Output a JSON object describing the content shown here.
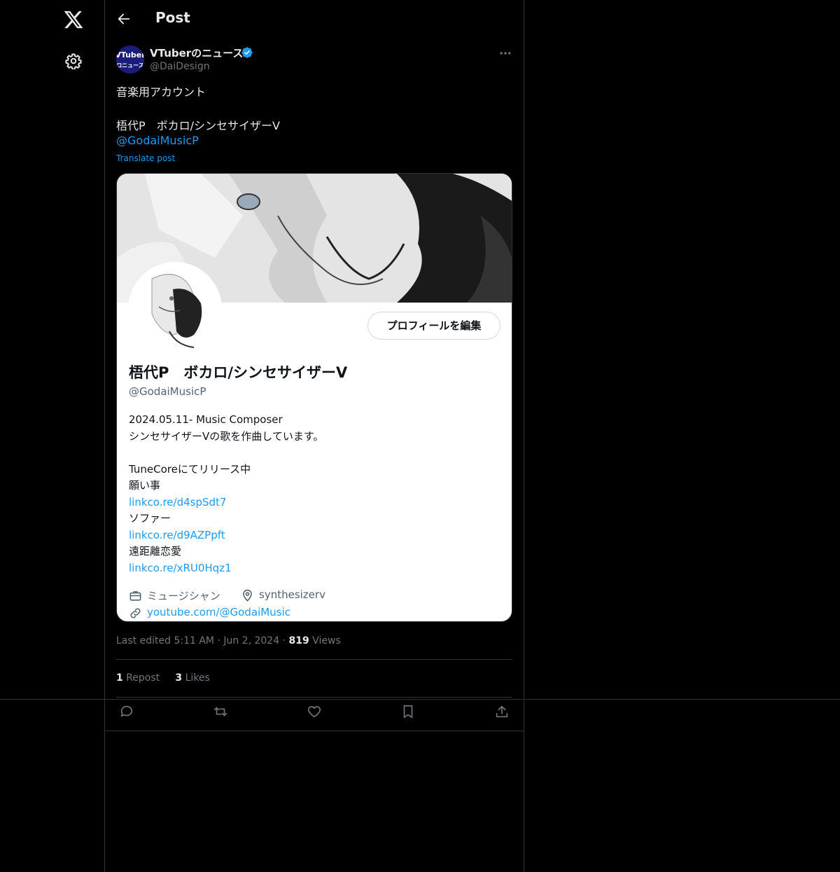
{
  "header": {
    "title": "Post"
  },
  "post": {
    "author_name": "VTuberのニュース",
    "author_handle": "@DaiDesign",
    "avatar_text": "VTuber ロニュース",
    "text": "音楽用アカウント\n\n梧代P　ボカロ/シンセサイザーV",
    "mention": "@GodaiMusicP",
    "translate_label": "Translate post",
    "timestamp": "Last edited 5:11 AM",
    "date": "Jun 2, 2024",
    "views_count": "819",
    "views_label": "Views",
    "reposts_count": "1",
    "reposts_label": "Repost",
    "likes_count": "3",
    "likes_label": "Likes"
  },
  "card": {
    "edit_button": "プロフィールを編集",
    "name": "梧代P　ボカロ/シンセサイザーV",
    "handle": "@GodaiMusicP",
    "bio": [
      {
        "text": "2024.05.11- Music Composer",
        "link": false
      },
      {
        "text": "シンセサイザーVの歌を作曲しています。",
        "link": false
      },
      {
        "text": "",
        "link": false
      },
      {
        "text": "TuneCoreにてリリース中",
        "link": false
      },
      {
        "text": "願い事",
        "link": false
      },
      {
        "text": "linkco.re/d4spSdt7",
        "link": true
      },
      {
        "text": "ソファー",
        "link": false
      },
      {
        "text": "linkco.re/d9AZPpft",
        "link": true
      },
      {
        "text": "遠距離恋愛",
        "link": false
      },
      {
        "text": "linkco.re/xRU0Hqz1",
        "link": true
      }
    ],
    "job": "ミュージシャン",
    "location": "synthesizerv",
    "url": "youtube.com/@GodaiMusic"
  },
  "colors": {
    "accent": "#1d9bf0",
    "background": "#000000",
    "border": "#2f3336",
    "muted": "#71767b"
  }
}
